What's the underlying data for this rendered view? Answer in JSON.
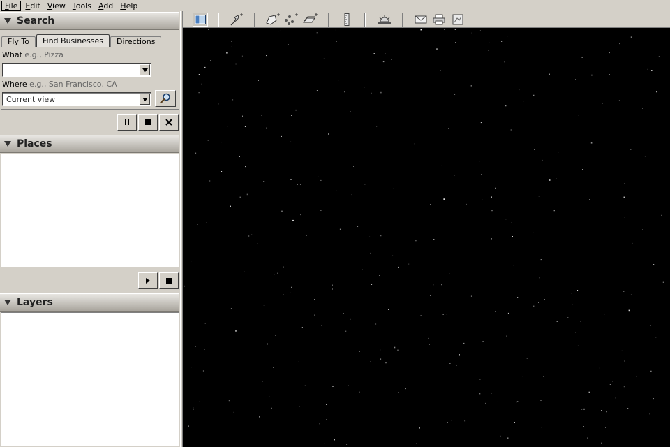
{
  "menu": {
    "items": [
      {
        "label": "File",
        "active": true
      },
      {
        "label": "Edit"
      },
      {
        "label": "View"
      },
      {
        "label": "Tools"
      },
      {
        "label": "Add"
      },
      {
        "label": "Help"
      }
    ]
  },
  "search_panel": {
    "title": "Search",
    "tabs": [
      "Fly To",
      "Find Businesses",
      "Directions"
    ],
    "selected_tab": "Find Businesses",
    "what_label": "What",
    "what_hint": "e.g., Pizza",
    "what_value": "",
    "where_label": "Where",
    "where_hint": "e.g., San Francisco, CA",
    "where_value": "Current view",
    "search_icon": "magnifier-icon"
  },
  "search_controls": {
    "pause_icon": "pause-icon",
    "stop_icon": "stop-icon",
    "close_icon": "close-icon"
  },
  "places_panel": {
    "title": "Places",
    "items": []
  },
  "tour_controls": {
    "play_icon": "play-icon",
    "stop_icon": "stop-icon"
  },
  "layers_panel": {
    "title": "Layers",
    "items": []
  },
  "toolbar": {
    "tools": [
      "sidebar-toggle-icon",
      "add-placemark-icon",
      "add-polygon-icon",
      "add-path-icon",
      "add-image-overlay-icon",
      "ruler-icon",
      "sunlight-icon",
      "email-icon",
      "print-icon",
      "google-maps-icon"
    ]
  },
  "colors": {
    "chrome": "#d4d0c8",
    "viewport_bg": "#000000",
    "star": "#ffffff"
  }
}
